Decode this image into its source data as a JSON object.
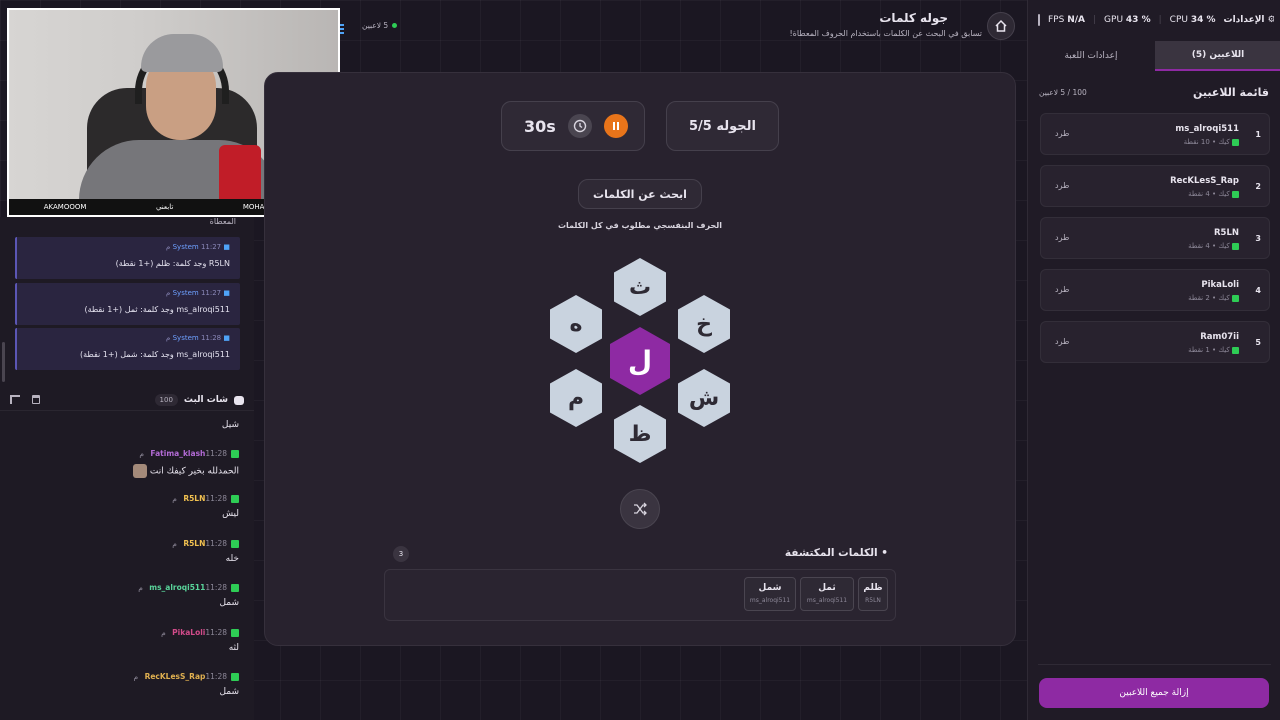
{
  "header": {
    "title": "جوله كلمات",
    "subtitle": "تسابق في البحث عن الكلمات باستخدام الحروف المعطاة!",
    "players_online": "5 لاعبين"
  },
  "webcam": {
    "overlay_left": "AKAMOOOM",
    "overlay_mid": "تابعني",
    "overlay_right": "MOHAMMED OXX"
  },
  "left_chat": {
    "partial_top": "المعطاة",
    "system_messages": [
      {
        "name": "System",
        "time": "11:27 م",
        "text": "R5LN وجد كلمة: ظلم (+1 نقطة)"
      },
      {
        "name": "System",
        "time": "11:27 م",
        "text": "ms_alroqi511 وجد كلمة: ثمل (+1 نقطة)"
      },
      {
        "name": "System",
        "time": "11:28 م",
        "text": "ms_alroqi511 وجد كلمة: شمل (+1 نقطة)"
      }
    ],
    "title": "شات البث",
    "count": "100",
    "messages": [
      {
        "user": "",
        "time": "",
        "text": "شيل",
        "color": "#e8e4ee"
      },
      {
        "user": "Fatima_klash",
        "time": "11:28 م",
        "text": "الحمدلله بخير كيفك انت",
        "color": "#b36bd6"
      },
      {
        "user": "R5LN",
        "time": "11:28 م",
        "text": "ليش",
        "color": "#f0c050"
      },
      {
        "user": "R5LN",
        "time": "11:28 م",
        "text": "خله",
        "color": "#f0c050"
      },
      {
        "user": "ms_alroqi511",
        "time": "11:28 م",
        "text": "شمل",
        "color": "#59d49a"
      },
      {
        "user": "PikaLoli",
        "time": "11:28 م",
        "text": "لثه",
        "color": "#d24b8a"
      },
      {
        "user": "RecKLesS_Rap",
        "time": "11:28 م",
        "text": "شمل",
        "color": "#e0b050"
      }
    ]
  },
  "game": {
    "round_label": "الجوله 5/5",
    "timer": "30s",
    "find_words_label": "ابحث عن الكلمات",
    "required_note": "الحرف البنفسجي مطلوب في كل الكلمات",
    "center_letter": "ل",
    "outer_letters": [
      "ث",
      "خ",
      "ش",
      "ظ",
      "م",
      "ه"
    ],
    "found_title": "الكلمات المكتشفة",
    "found_count": "3",
    "found_words": [
      {
        "word": "ظلم",
        "by": "R5LN"
      },
      {
        "word": "ثمل",
        "by": "ms_alroqi511"
      },
      {
        "word": "شمل",
        "by": "ms_alroqi511"
      }
    ]
  },
  "stats": {
    "fps_label": "FPS",
    "fps_value": "N/A",
    "gpu_label": "GPU",
    "gpu_value": "43 %",
    "cpu_label": "CPU",
    "cpu_value": "34 %",
    "settings_label": "الإعدادات"
  },
  "right_panel": {
    "tab_players": "اللاعبين (5)",
    "tab_settings": "إعدادات اللعبة",
    "list_title": "قائمة اللاعبين",
    "capacity": "100 / 5 لاعبين",
    "kick_label": "طرد",
    "players": [
      {
        "rank": "1",
        "name": "ms_alroqi511",
        "points": "10 نقطة",
        "platform": "كيك"
      },
      {
        "rank": "2",
        "name": "RecKLesS_Rap",
        "points": "4 نقطة",
        "platform": "كيك"
      },
      {
        "rank": "3",
        "name": "R5LN",
        "points": "4 نقطة",
        "platform": "كيك"
      },
      {
        "rank": "4",
        "name": "PikaLoli",
        "points": "2 نقطة",
        "platform": "كيك"
      },
      {
        "rank": "5",
        "name": "Ram07ii",
        "points": "1 نقطة",
        "platform": "كيك"
      }
    ],
    "remove_all": "إزالة جميع اللاعبين"
  },
  "colors": {
    "accent_purple": "#8e2aa3",
    "hex_tile": "#c9d3df",
    "timer_orange": "#e8741a",
    "kick_green": "#2ecc55"
  }
}
